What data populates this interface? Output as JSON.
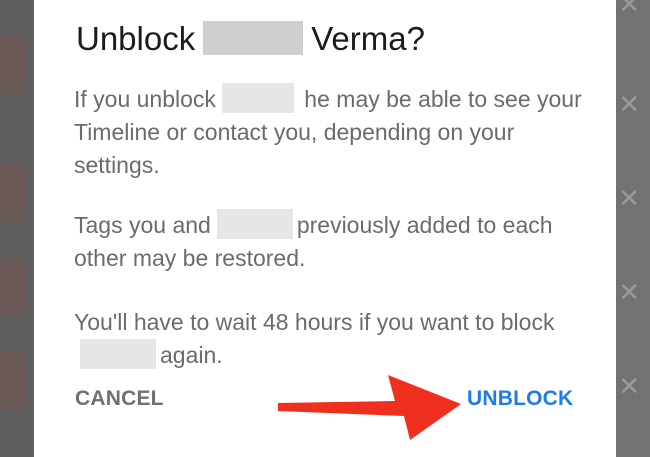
{
  "dialog": {
    "title_prefix": "Unblock",
    "title_suffix": "Verma?",
    "para1_a": "If you unblock",
    "para1_b": " he may be able to see your Timeline or contact you, depending on your settings.",
    "para2_a": "Tags you and",
    "para2_b": "previously added to each other may be restored.",
    "para3_a": "You'll have to wait 48 hours if you want to block",
    "para3_b": "again.",
    "cancel_label": "CANCEL",
    "unblock_label": "UNBLOCK"
  },
  "colors": {
    "accent": "#1e7ce6",
    "arrow": "#f0301e"
  },
  "icons": {
    "background_close": "close-icon",
    "annotation": "arrow-icon"
  }
}
